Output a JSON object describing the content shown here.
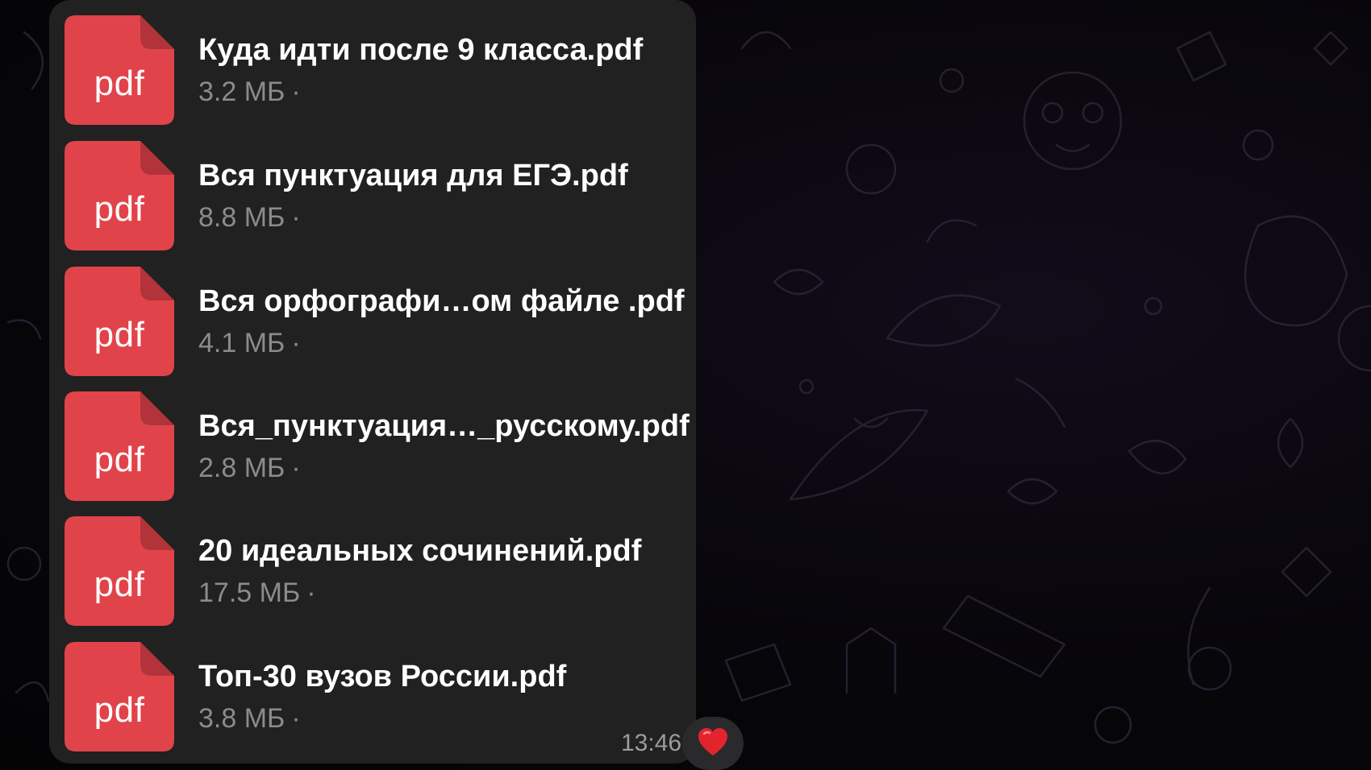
{
  "theme": {
    "bubble_color": "#212121",
    "file_icon_color": "#e1434a",
    "file_icon_fold_color": "#b2333a",
    "text_primary": "#ffffff",
    "text_secondary": "#8b8b8f"
  },
  "message": {
    "files": [
      {
        "icon": "pdf-file-icon",
        "ext": "pdf",
        "name": "Куда идти после 9 класса.pdf",
        "size": "3.2 МБ",
        "sep": "·"
      },
      {
        "icon": "pdf-file-icon",
        "ext": "pdf",
        "name": "Вся пунктуация для ЕГЭ.pdf",
        "size": "8.8 МБ",
        "sep": "·"
      },
      {
        "icon": "pdf-file-icon",
        "ext": "pdf",
        "name": "Вся орфографи…ом файле .pdf",
        "size": "4.1 МБ",
        "sep": "·"
      },
      {
        "icon": "pdf-file-icon",
        "ext": "pdf",
        "name": "Вся_пунктуация…_русскому.pdf",
        "size": "2.8 МБ",
        "sep": "·"
      },
      {
        "icon": "pdf-file-icon",
        "ext": "pdf",
        "name": "20 идеальных сочинений.pdf",
        "size": "17.5 МБ",
        "sep": "·"
      },
      {
        "icon": "pdf-file-icon",
        "ext": "pdf",
        "name": "Топ-30 вузов России.pdf",
        "size": "3.8 МБ",
        "sep": "·"
      }
    ],
    "time": "13:46",
    "reaction": {
      "icon": "red-heart-icon",
      "color": "#e4242c"
    }
  }
}
